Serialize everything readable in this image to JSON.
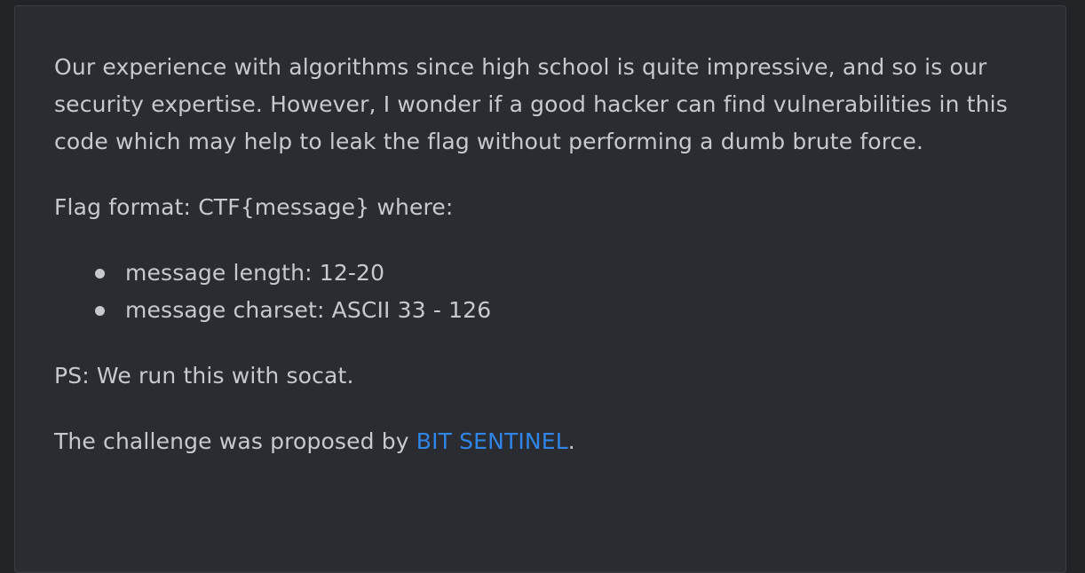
{
  "description": {
    "paragraph1": "Our experience with algorithms since high school is quite impressive, and so is our security expertise. However, I wonder if a good hacker can find vulnerabilities in this code which may help to leak the flag without performing a dumb brute force.",
    "flag_format": "Flag format: CTF{message} where:",
    "requirements": [
      "message length: 12-20",
      "message charset: ASCII 33 - 126"
    ],
    "ps": "PS: We run this with socat.",
    "proposer_prefix": "The challenge was proposed by ",
    "proposer_link": "BIT SENTINEL",
    "proposer_suffix": "."
  },
  "colors": {
    "background": "#212327",
    "panel": "#2a2c31",
    "text": "#c8c9cc",
    "link": "#2f86e8"
  }
}
